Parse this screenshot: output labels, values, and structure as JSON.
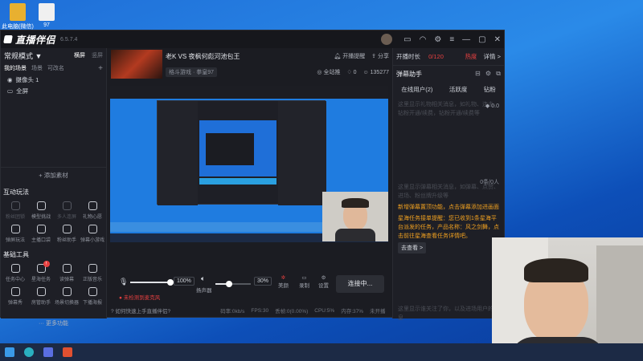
{
  "desktop": {
    "icons": [
      {
        "label": "此电脑(微信)",
        "color": "#e8b030"
      },
      {
        "label": "97",
        "color": "#f0f0f0"
      }
    ]
  },
  "window": {
    "app_name": "直播伴侣",
    "version": "6.5.7.4",
    "title_icons": [
      "chat-icon",
      "headset-icon",
      "settings-icon",
      "menu-icon",
      "minimize-icon",
      "restore-icon",
      "close-icon"
    ]
  },
  "left": {
    "scene_mode": "常规模式 ▼",
    "scene_tabs": [
      "横屏",
      "竖屏"
    ],
    "sub_tabs": [
      "我的场景",
      "场景",
      "可改名"
    ],
    "add_icon": "+",
    "sources": [
      "摄像头 1",
      "全屏"
    ],
    "add_source": "+ 添加素材",
    "interactive_title": "互动玩法",
    "interactive": [
      {
        "label": "粉丝团锁",
        "dim": true
      },
      {
        "label": "模型挑战",
        "dim": false
      },
      {
        "label": "多人连屏",
        "dim": true
      },
      {
        "label": "礼物心愿",
        "dim": false
      },
      {
        "label": "弹屏玩法",
        "dim": false
      },
      {
        "label": "主播口袋",
        "dim": false
      },
      {
        "label": "粉丝助手",
        "dim": false
      },
      {
        "label": "弹幕小游戏",
        "dim": false
      }
    ],
    "tools_title": "基础工具",
    "tools": [
      {
        "label": "任务中心",
        "badge": ""
      },
      {
        "label": "星海任务",
        "badge": "!"
      },
      {
        "label": "读弹幕",
        "badge": ""
      },
      {
        "label": "正版音乐",
        "badge": ""
      },
      {
        "label": "弹幕秀",
        "badge": ""
      },
      {
        "label": "房管助手",
        "badge": ""
      },
      {
        "label": "场景切换器",
        "badge": ""
      },
      {
        "label": "下播海报",
        "badge": ""
      }
    ],
    "more": "··· 更多功能"
  },
  "center": {
    "stream_title": "老K VS 夜枫何彪河池包王",
    "category": "格斗游戏 · 拳皇97",
    "live_reminder": "开播提醒",
    "share": "分享",
    "visibility": "全站推",
    "likes": "0",
    "viewers": "135277",
    "mic_pct": "100%",
    "speaker_label": "扬声器",
    "speaker_pct": "30%",
    "buttons": [
      "美颜",
      "录制",
      "设置"
    ],
    "go_live": "连接中...",
    "warning": "未检测到麦克风",
    "help": "如何快速上手直播伴侣?",
    "status": [
      "码率:0kb/s",
      "FPS:30",
      "丢帧:0(0.00%)",
      "CPU:5%",
      "内存:37%",
      "未开播"
    ]
  },
  "right": {
    "live_time_label": "开播时长",
    "live_time": "0/120",
    "hot": "热度",
    "details": "详情 >",
    "danmu_title": "弹幕助手",
    "tabs": [
      "在线用户(2)",
      "活跃度",
      "钻粉"
    ],
    "diamond": "0.0",
    "notice1": "这里显示礼物相关消息，如礼物、连击、钻粉开通/续费，钻粉开通/续费等",
    "count": "0条/0人",
    "notice2": "这里显示弹幕相关消息，如弹幕、点赞、进场、粉丝牌升级等",
    "tip1": "新增弹幕置顶功能，点击弹幕添加进画面",
    "tip2": "星海任务接单提醒：您已收到1条星海平台派发的任务，产品名称：风之剑舞，点击前往星海查看任务详情吧。",
    "go_view": "去查看 >",
    "notice3": "这里显示谁关注了你，以及进场用户的消息"
  },
  "taskbar": {
    "icons": [
      "windows-icon",
      "edge-icon",
      "store-icon",
      "app-icon"
    ]
  }
}
